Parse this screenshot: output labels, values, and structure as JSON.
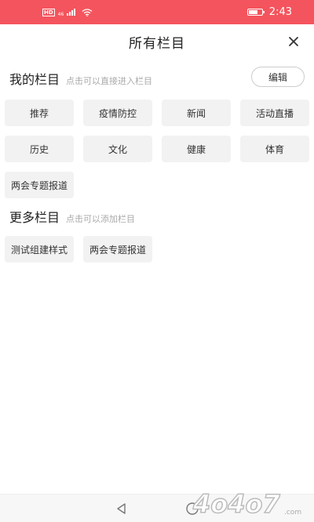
{
  "status_bar": {
    "hd_badge": "HD",
    "network": "46",
    "time": "2:43",
    "battery_level": 0.7,
    "color": "#f4545d"
  },
  "header": {
    "title": "所有栏目",
    "close_icon": "close-icon"
  },
  "my_section": {
    "title": "我的栏目",
    "hint": "点击可以直接进入栏目",
    "edit_label": "编辑",
    "items": [
      {
        "label": "推荐"
      },
      {
        "label": "疫情防控"
      },
      {
        "label": "新闻"
      },
      {
        "label": "活动直播"
      },
      {
        "label": "历史"
      },
      {
        "label": "文化"
      },
      {
        "label": "健康"
      },
      {
        "label": "体育"
      },
      {
        "label": "两会专题报道"
      }
    ]
  },
  "more_section": {
    "title": "更多栏目",
    "hint": "点击可以添加栏目",
    "items": [
      {
        "label": "测试组建样式"
      },
      {
        "label": "两会专题报道"
      }
    ]
  },
  "nav": {
    "back_icon": "back-triangle-icon",
    "home_icon": "home-circle-icon"
  },
  "watermark": {
    "text": "4o4o7",
    "suffix": ".com"
  }
}
